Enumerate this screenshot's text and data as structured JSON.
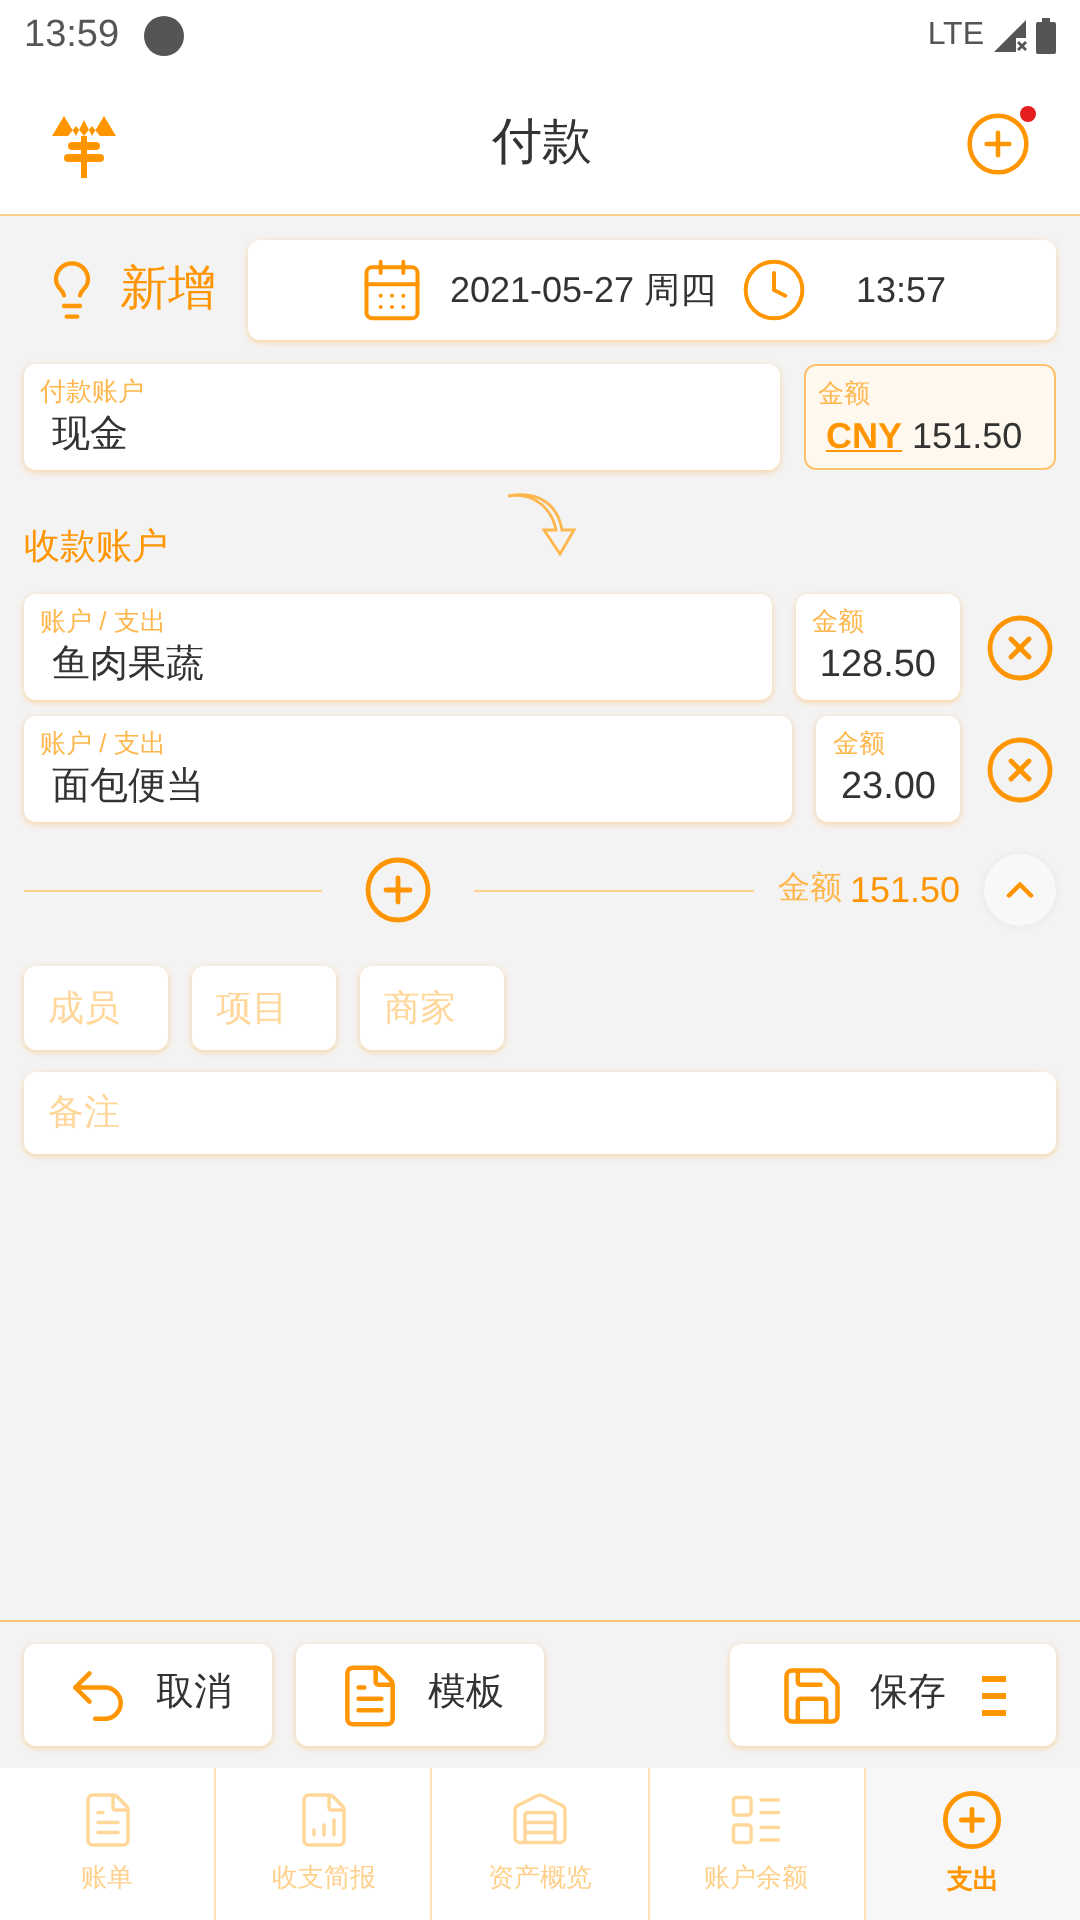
{
  "status_bar": {
    "time": "13:59",
    "network": "LTE"
  },
  "header": {
    "title": "付款",
    "notification_dot": true
  },
  "entry": {
    "mode": "新增",
    "date": "2021-05-27 周四",
    "time": "13:57"
  },
  "payer": {
    "label": "付款账户",
    "value": "现金",
    "amount_label": "金额",
    "currency": "CNY",
    "amount": "151.50"
  },
  "payees_title": "收款账户",
  "payees": [
    {
      "label": "账户 / 支出",
      "value": "鱼肉果蔬",
      "amount_label": "金额",
      "amount": "128.50"
    },
    {
      "label": "账户 / 支出",
      "value": "面包便当",
      "amount_label": "金额",
      "amount": "23.00"
    }
  ],
  "total": {
    "label": "金额",
    "amount": "151.50",
    "expanded": true
  },
  "tags": [
    {
      "placeholder": "成员"
    },
    {
      "placeholder": "项目"
    },
    {
      "placeholder": "商家"
    }
  ],
  "memo": {
    "placeholder": "备注"
  },
  "actions": [
    {
      "label": "取消",
      "kind": "cancel"
    },
    {
      "label": "模板",
      "kind": "template"
    },
    {
      "label": "保存",
      "kind": "save"
    }
  ],
  "tabs": [
    {
      "label": "账单",
      "selected": false
    },
    {
      "label": "收支简报",
      "selected": false
    },
    {
      "label": "资产概览",
      "selected": false
    },
    {
      "label": "账户余额",
      "selected": false
    },
    {
      "label": "支出",
      "selected": true
    }
  ]
}
